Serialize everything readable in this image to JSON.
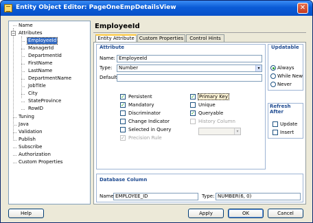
{
  "window": {
    "title": "Entity Object Editor: PageOneEmpDetailsView",
    "close_glyph": "✕"
  },
  "nav": {
    "items": [
      "Name",
      "Attributes",
      "EmployeeId",
      "ManagerId",
      "DepartmentId",
      "FirstName",
      "LastName",
      "DepartmentName",
      "JobTitle",
      "City",
      "StateProvince",
      "RowID",
      "Tuning",
      "Java",
      "Validation",
      "Publish",
      "Subscribe",
      "Authorization",
      "Custom Properties"
    ],
    "expander_glyph": "−",
    "selected": "EmployeeId"
  },
  "editor": {
    "heading": "EmployeeId",
    "tabs": [
      "Entity Attribute",
      "Custom Properties",
      "Control Hints"
    ],
    "attribute": {
      "title": "Attribute",
      "name_label": "Name:",
      "name_value": "EmployeeId",
      "type_label": "Type:",
      "type_value": "Number",
      "default_label": "Default:",
      "default_value": "",
      "dropdown_glyph": "▾"
    },
    "checkboxes": {
      "persistent": {
        "label": "Persistent",
        "checked": true
      },
      "mandatory": {
        "label": "Mandatory",
        "checked": true
      },
      "discriminator": {
        "label": "Discriminator",
        "checked": false
      },
      "change_indicator": {
        "label": "Change Indicator",
        "checked": false
      },
      "selected_in_query": {
        "label": "Selected in Query",
        "checked": false
      },
      "precision_rule": {
        "label": "Precision Rule",
        "checked": true
      },
      "primary_key": {
        "label": "Primary Key",
        "checked": true
      },
      "unique": {
        "label": "Unique",
        "checked": false
      },
      "queryable": {
        "label": "Queryable",
        "checked": true
      },
      "history_column": {
        "label": "History Column",
        "checked": false
      },
      "check_glyph": "✓"
    },
    "updatable": {
      "title": "Updatable",
      "options": [
        "Always",
        "While New",
        "Never"
      ],
      "selected": "Always"
    },
    "refresh_after": {
      "title": "Refresh After",
      "update_label": "Update",
      "insert_label": "Insert"
    },
    "database_column": {
      "title": "Database Column",
      "name_label": "Name:",
      "name_value": "EMPLOYEE_ID",
      "type_label": "Type:",
      "type_value": "NUMBER(6, 0)"
    }
  },
  "buttons": {
    "help": "Help",
    "apply": "Apply",
    "ok": "OK",
    "cancel": "Cancel"
  },
  "colors": {
    "titlebar": "#0A5BD6",
    "selection": "#316AC5",
    "group_title": "#1F4B91",
    "check": "#21A121"
  }
}
